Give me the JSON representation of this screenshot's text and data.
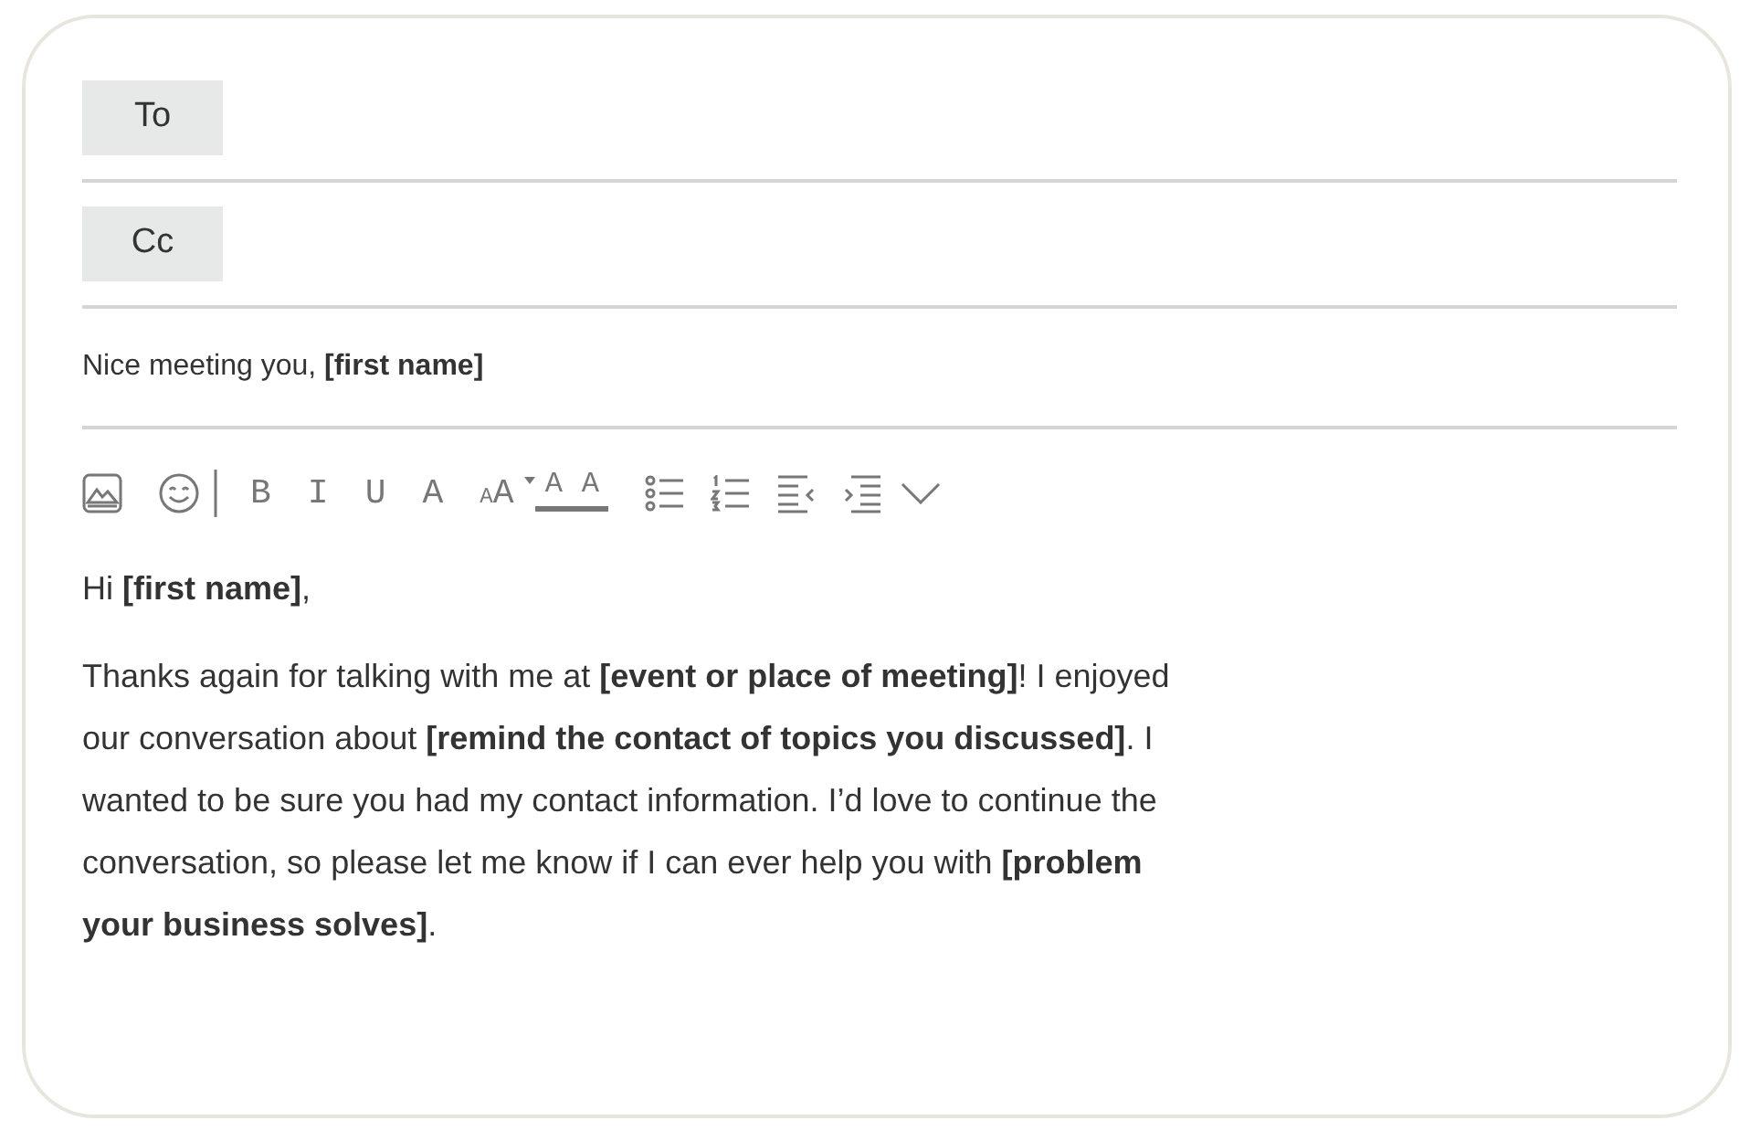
{
  "recipients": [
    {
      "label": "To"
    },
    {
      "label": "Cc"
    }
  ],
  "subject": "Nice meeting you, **[first name]**",
  "toolbar": [
    {
      "kind": "image"
    },
    {
      "kind": "emoji"
    },
    {
      "kind": "separator"
    },
    {
      "kind": "letter",
      "label": "B"
    },
    {
      "kind": "letter",
      "label": "I"
    },
    {
      "kind": "letter",
      "label": "U"
    },
    {
      "kind": "letter",
      "label": "A"
    },
    {
      "kind": "fontsize",
      "small": "A",
      "large": "A"
    },
    {
      "kind": "textcolor",
      "label": "A"
    },
    {
      "kind": "highlight",
      "label": "A"
    },
    {
      "kind": "bullets"
    },
    {
      "kind": "numbers"
    },
    {
      "kind": "outdent"
    },
    {
      "kind": "indent"
    },
    {
      "kind": "more"
    }
  ],
  "body": [
    "Hi **[first name]**,",
    "Thanks again for talking with me at **[event or place of meeting]**! I enjoyed our conversation about **[remind the contact of topics you discussed]**. I wanted to be sure you had my contact information. I’d love to continue the conversation, so please let me know if I can ever help you with **[problem your business solves]**."
  ]
}
